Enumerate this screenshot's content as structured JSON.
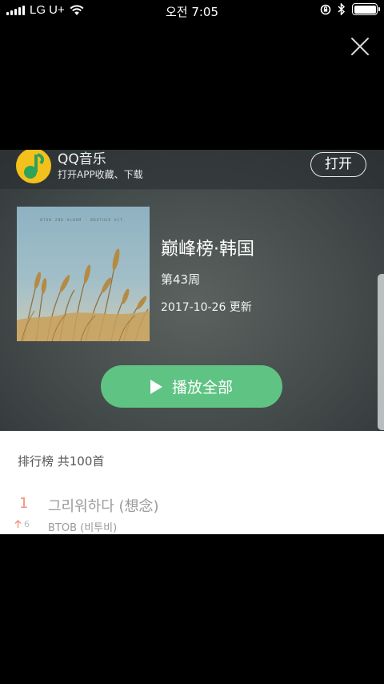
{
  "status_bar": {
    "carrier": "LG U+",
    "time": "오전 7:05"
  },
  "app_banner": {
    "title": "QQ音乐",
    "subtitle": "打开APP收藏、下载",
    "open_label": "打开"
  },
  "chart": {
    "title": "巅峰榜·韩国",
    "week": "第43周",
    "updated": "2017-10-26 更新",
    "cover_caption": "BTOB 2ND ALBUM · BROTHER ACT."
  },
  "play_all_label": "播放全部",
  "list": {
    "header": "排行榜 共100首",
    "songs": [
      {
        "rank": "1",
        "title": "그리워하다 (想念)",
        "trend_icon": "up-arrow",
        "trend_count": "6",
        "artist": "BTOB (비투비)"
      }
    ]
  },
  "colors": {
    "accent_green": "#5fc383",
    "rank_orange": "#f0957a",
    "qq_yellow": "#f4c01b",
    "qq_green": "#2ea35a"
  }
}
